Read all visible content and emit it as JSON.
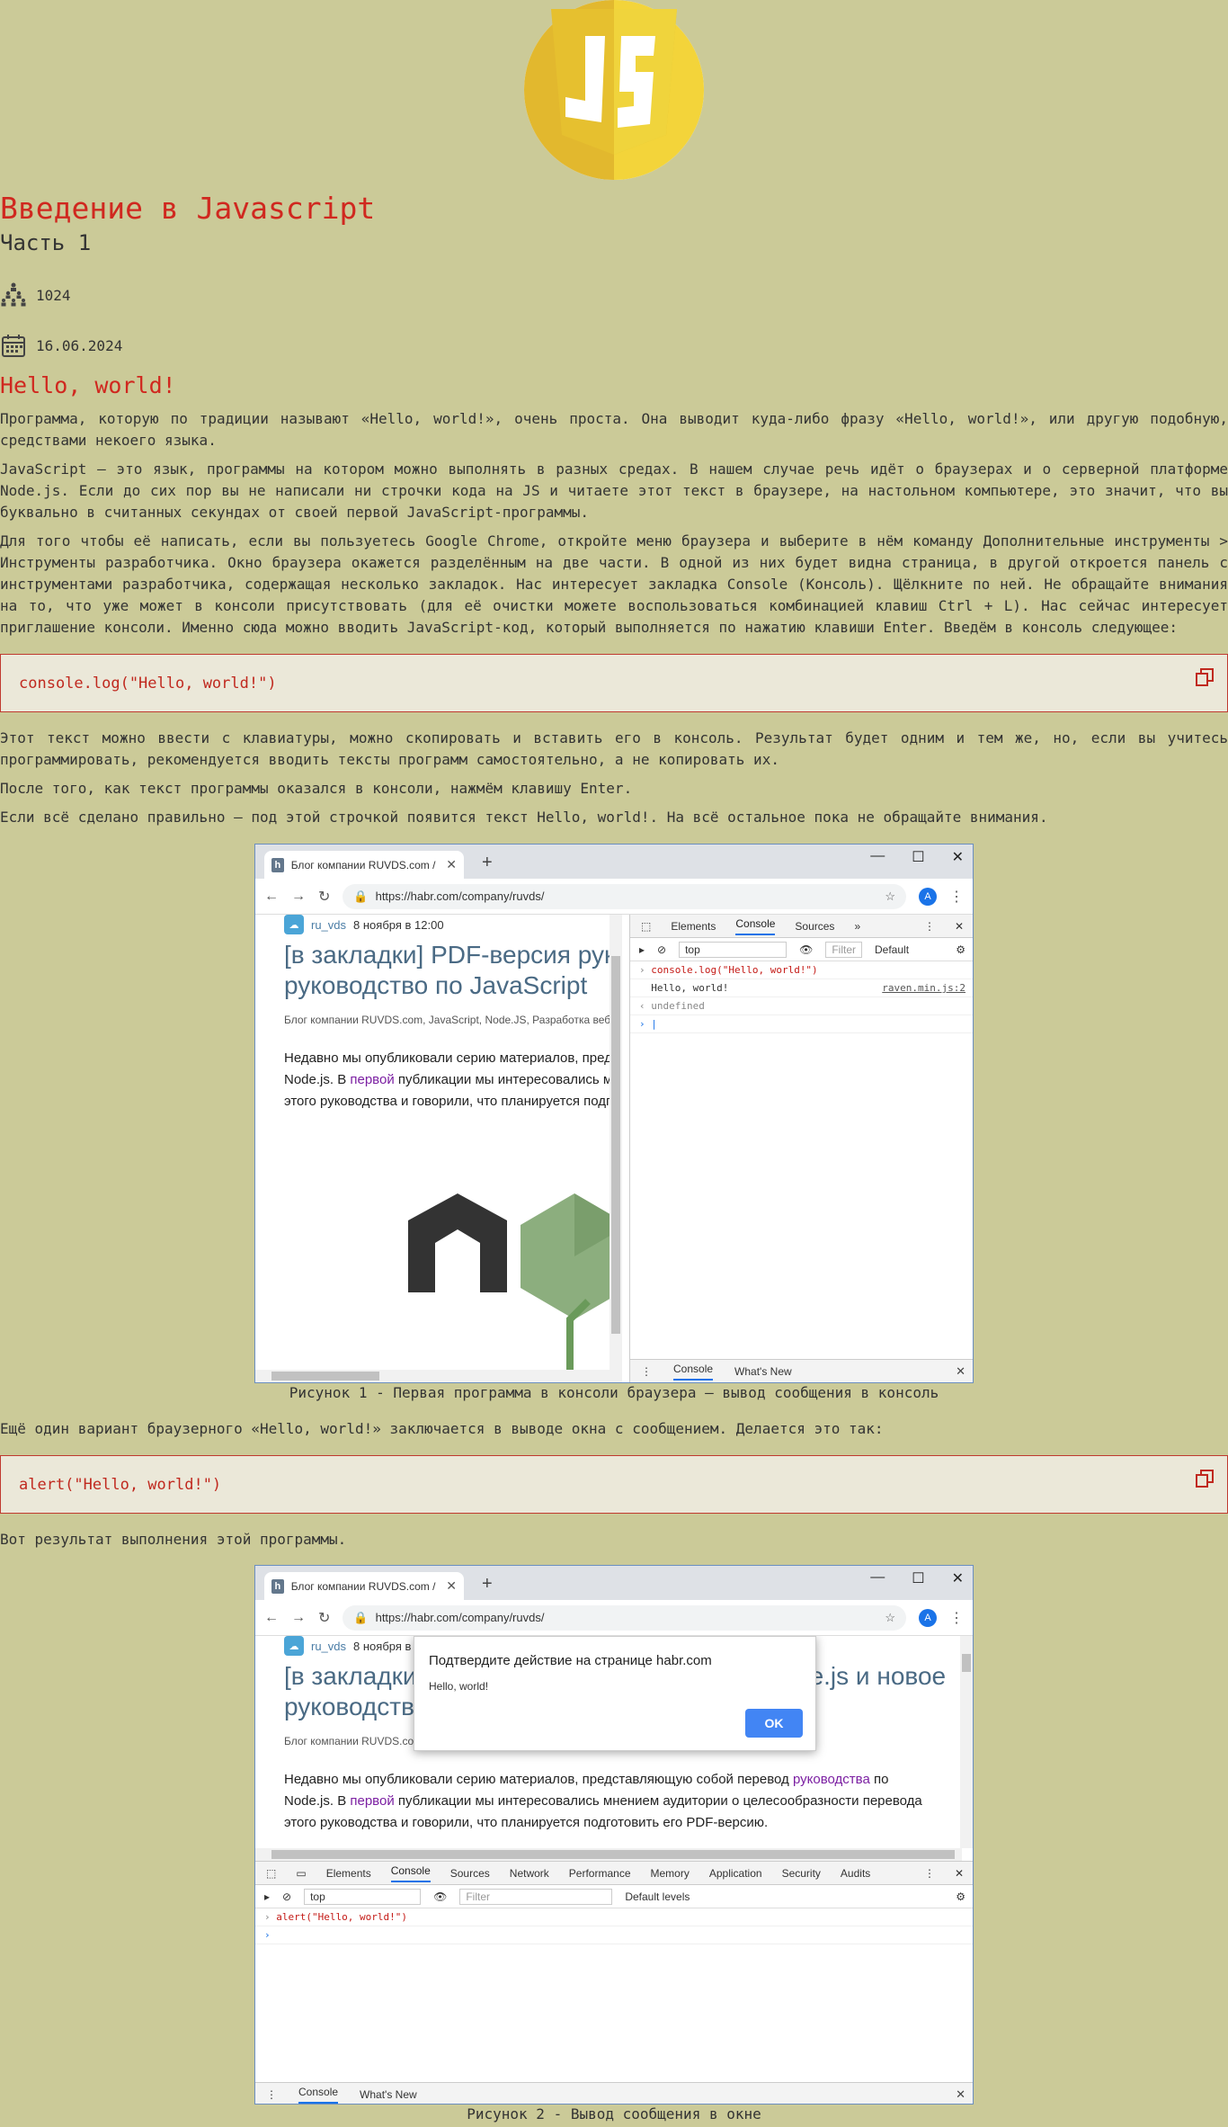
{
  "header": {
    "logo_alt": "JS",
    "title": "Введение в Javascript",
    "subtitle": "Часть 1",
    "views": "1024",
    "date": "16.06.2024"
  },
  "section": {
    "heading": "Hello, world!",
    "p1": "Программа, которую по традиции называют «Hello, world!», очень проста. Она выводит куда-либо фразу «Hello, world!», или другую подобную, средствами некоего языка.",
    "p2": "JavaScript — это язык, программы на котором можно выполнять в разных средах. В нашем случае речь идёт о браузерах и о серверной платформе Node.js. Если до сих пор вы не написали ни строчки кода на JS и читаете этот текст в браузере, на настольном компьютере, это значит, что вы буквально в считанных секундах от своей первой JavaScript-программы.",
    "p3": "Для того чтобы её написать, если вы пользуетесь Google Chrome, откройте меню браузера и выберите в нём команду Дополнительные инструменты > Инструменты разработчика. Окно браузера окажется разделённым на две части. В одной из них будет видна страница, в другой откроется панель с инструментами разработчика, содержащая несколько закладок. Нас интересует закладка Console (Консоль). Щёлкните по ней. Не обращайте внимания на то, что уже может в консоли присутствовать (для её очистки можете воспользоваться комбинацией клавиш Ctrl + L). Нас сейчас интересует приглашение консоли. Именно сюда можно вводить JavaScript-код, который выполняется по нажатию клавиши Enter. Введём в консоль следующее:",
    "code1": "console.log(\"Hello, world!\")",
    "p4": "Этот текст можно ввести с клавиатуры, можно скопировать и вставить его в консоль. Результат будет одним и тем же, но, если вы учитесь программировать, рекомендуется вводить тексты программ самостоятельно, а не копировать их.",
    "p5": "После того, как текст программы оказался в консоли, нажмём клавишу Enter.",
    "p6": "Если всё сделано правильно — под этой строчкой появится текст Hello, world!. На всё остальное пока не обращайте внимания.",
    "caption1": "Рисунок 1 - Первая программа в консоли браузера — вывод сообщения в консоль",
    "p7": "Ещё один вариант браузерного «Hello, world!» заключается в выводе окна с сообщением. Делается это так:",
    "code2": "alert(\"Hello, world!\")",
    "p8": "Вот результат выполнения этой программы.",
    "caption2": "Рисунок 2 - Вывод сообщения в окне"
  },
  "browser": {
    "tab_title": "Блог компании RUVDS.com / Хабр",
    "url": "https://habr.com/company/ruvds/",
    "avatar": "A",
    "author": "ru_vds",
    "posted": "8 ноября в 12:00",
    "article_title_1": "[в закладки] PDF-версия руководства по Node.js и новое",
    "article_title_2": "руководство по JavaScript",
    "tags": "Блог компании RUVDS.com,  JavaScript,  Node.JS,  Разработка веб-сайтов",
    "text_1a": "Недавно мы опубликовали серию материалов, представляющую собой перевод ",
    "text_1b": "руководства",
    "text_1c": " по",
    "text_2a": "Node.js. В ",
    "text_2b": "первой",
    "text_2c": " публикации мы интересовались мнением аудитории о целесообразности перевода",
    "text_3": "этого руководства и говорили, что планируется подготовить его PDF-версию."
  },
  "devtools1": {
    "tabs": [
      "Elements",
      "Console",
      "Sources"
    ],
    "context": "top",
    "filter": "Filter",
    "levels": "Default",
    "cmd": "console.log(\"Hello, world!\")",
    "output": "Hello, world!",
    "source": "raven.min.js:2",
    "result": "undefined",
    "drawer_tabs": [
      "Console",
      "What's New"
    ]
  },
  "devtools2": {
    "tabs": [
      "Elements",
      "Console",
      "Sources",
      "Network",
      "Performance",
      "Memory",
      "Application",
      "Security",
      "Audits"
    ],
    "context": "top",
    "filter": "Filter",
    "levels": "Default levels",
    "cmd": "alert(\"Hello, world!\")",
    "drawer_tabs": [
      "Console",
      "What's New"
    ]
  },
  "dialog": {
    "title": "Подтвердите действие на странице habr.com",
    "message": "Hello, world!",
    "ok": "OK"
  }
}
